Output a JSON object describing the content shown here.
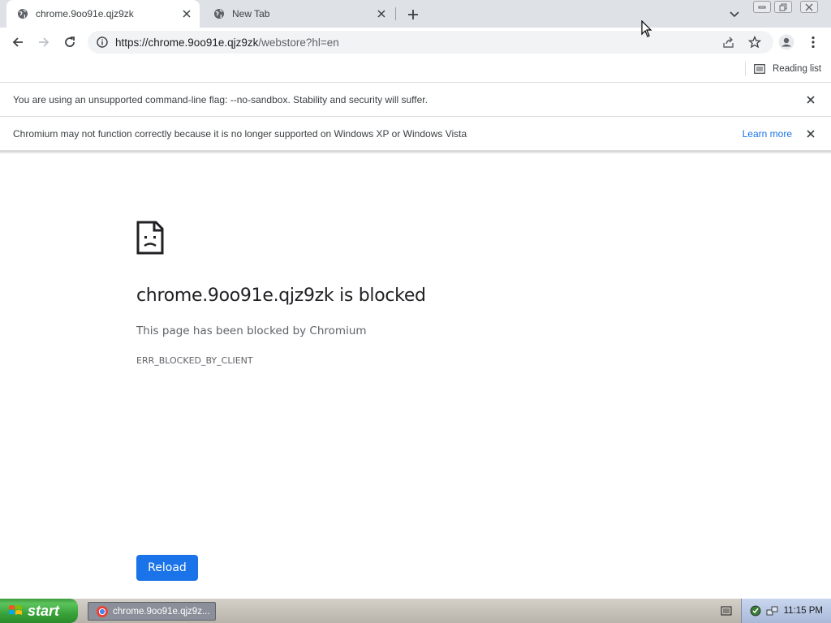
{
  "browser": {
    "tabs": [
      {
        "title": "chrome.9oo91e.qjz9zk",
        "active": true
      },
      {
        "title": "New Tab",
        "active": false
      }
    ],
    "address": {
      "scheme": "https://",
      "host": "chrome.9oo91e.qjz9zk",
      "path": "/webstore?hl=en"
    },
    "reading_list_label": "Reading list"
  },
  "infobars": [
    {
      "message": "You are using an unsupported command-line flag: --no-sandbox. Stability and security will suffer."
    },
    {
      "message": "Chromium may not function correctly because it is no longer supported on Windows XP or Windows Vista",
      "link": "Learn more"
    }
  ],
  "error_page": {
    "title": "chrome.9oo91e.qjz9zk is blocked",
    "description": "This page has been blocked by Chromium",
    "code": "ERR_BLOCKED_BY_CLIENT",
    "reload_label": "Reload"
  },
  "taskbar": {
    "start_label": "start",
    "task_item": "chrome.9oo91e.qjz9z...",
    "clock": "11:15 PM"
  },
  "colors": {
    "accent": "#1a73e8",
    "tabstrip": "#dee1e6"
  },
  "icons": [
    "globe-icon",
    "close-icon",
    "plus-icon",
    "chevron-down-icon",
    "minimize-icon",
    "restore-icon",
    "back-icon",
    "forward-icon",
    "reload-icon",
    "info-icon",
    "share-icon",
    "star-icon",
    "profile-icon",
    "menu-icon",
    "reading-list-icon",
    "sad-page-icon"
  ]
}
